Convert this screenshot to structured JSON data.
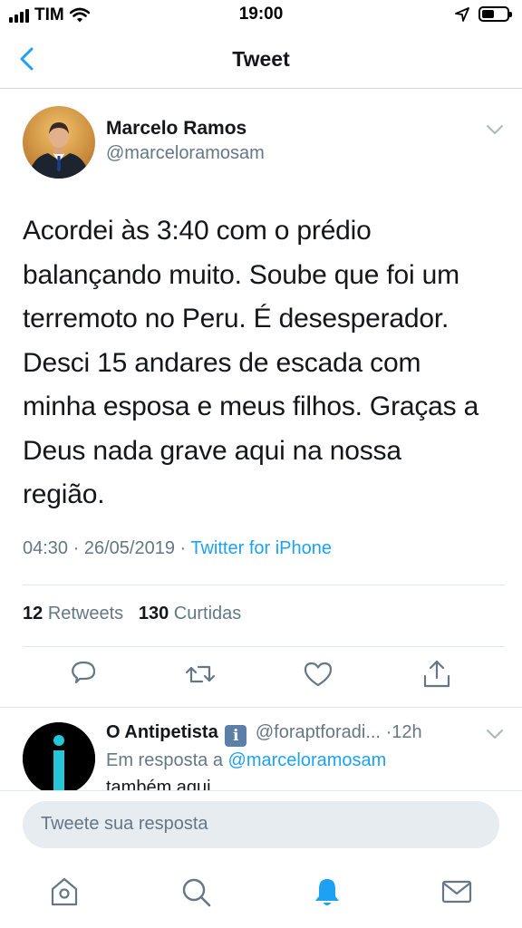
{
  "status_bar": {
    "carrier": "TIM",
    "time": "19:00"
  },
  "nav": {
    "title": "Tweet"
  },
  "tweet": {
    "author_name": "Marcelo Ramos",
    "author_handle": "@marceloramosam",
    "text_lines": [
      "Acordei às 3:40 com o prédio",
      "balançando muito. Soube que foi um",
      "terremoto no Peru. É desesperador.",
      "Desci 15 andares de escada com",
      "minha esposa e meus filhos. Graças a",
      "Deus nada grave aqui na nossa",
      "região."
    ],
    "time": "04:30",
    "date": "26/05/2019",
    "source": "Twitter for iPhone",
    "retweets_count": "12",
    "retweets_label": "Retweets",
    "likes_count": "130",
    "likes_label": "Curtidas"
  },
  "reply": {
    "author_name": "O Antipetista",
    "author_handle": "@foraptforadi...",
    "age": "12h",
    "reply_prefix": "Em resposta a",
    "reply_mention": "@marceloramosam",
    "text_partial": "também aqui ..."
  },
  "compose": {
    "placeholder": "Tweete sua resposta"
  },
  "colors": {
    "accent": "#1da1f2",
    "secondary_text": "#657786",
    "primary_text": "#14171a"
  },
  "icons": {
    "actions": [
      "reply-icon",
      "retweet-icon",
      "like-icon",
      "share-icon"
    ],
    "tabs": [
      "home-icon",
      "search-icon",
      "notifications-icon",
      "messages-icon"
    ]
  }
}
